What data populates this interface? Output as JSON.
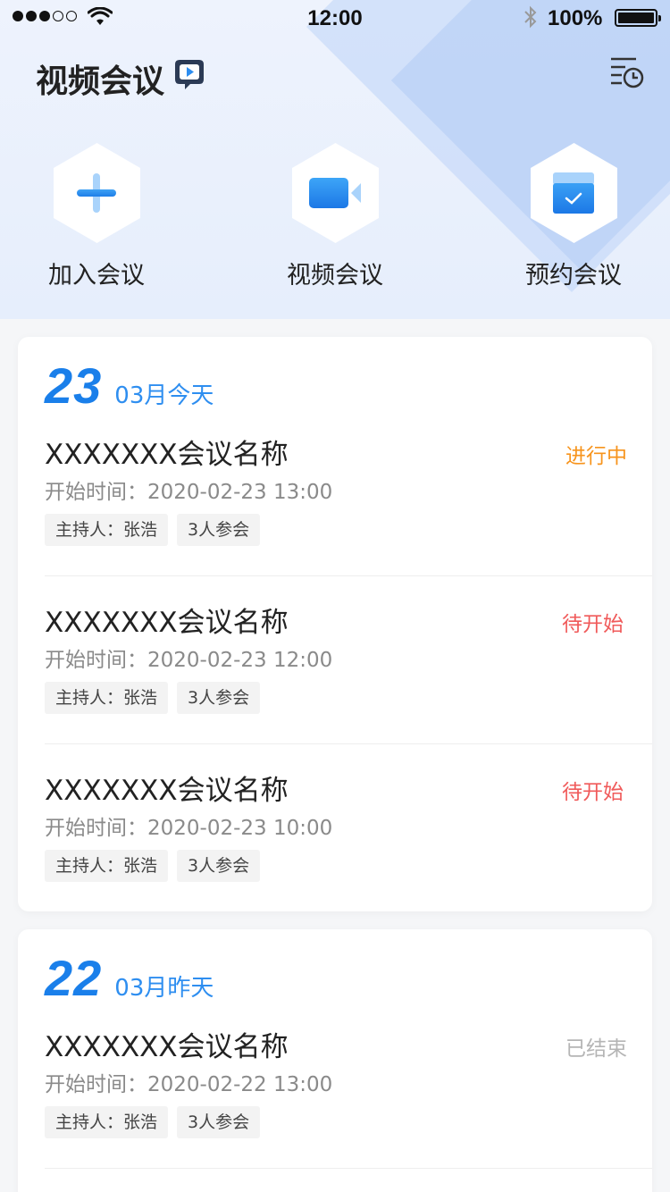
{
  "status_bar": {
    "time": "12:00",
    "battery": "100%"
  },
  "header": {
    "title": "视频会议"
  },
  "actions": [
    {
      "label": "加入会议",
      "icon": "plus-icon"
    },
    {
      "label": "视频会议",
      "icon": "video-camera-icon"
    },
    {
      "label": "预约会议",
      "icon": "calendar-check-icon"
    }
  ],
  "groups": [
    {
      "day": "23",
      "sub": "03月今天",
      "meetings": [
        {
          "name": "XXXXXXX会议名称",
          "status": "进行中",
          "status_color": "#f7941d",
          "time": "开始时间：2020-02-23 13:00",
          "host": "主持人：张浩",
          "count": "3人参会"
        },
        {
          "name": "XXXXXXX会议名称",
          "status": "待开始",
          "status_color": "#f05a5a",
          "time": "开始时间：2020-02-23 12:00",
          "host": "主持人：张浩",
          "count": "3人参会"
        },
        {
          "name": "XXXXXXX会议名称",
          "status": "待开始",
          "status_color": "#f05a5a",
          "time": "开始时间：2020-02-23 10:00",
          "host": "主持人：张浩",
          "count": "3人参会"
        }
      ]
    },
    {
      "day": "22",
      "sub": "03月昨天",
      "meetings": [
        {
          "name": "XXXXXXX会议名称",
          "status": "已结束",
          "status_color": "#b5b5b5",
          "time": "开始时间：2020-02-22 13:00",
          "host": "主持人：张浩",
          "count": "3人参会"
        }
      ]
    }
  ],
  "colors": {
    "accent": "#1a7fea",
    "header_bg": "#e9f0fd"
  }
}
